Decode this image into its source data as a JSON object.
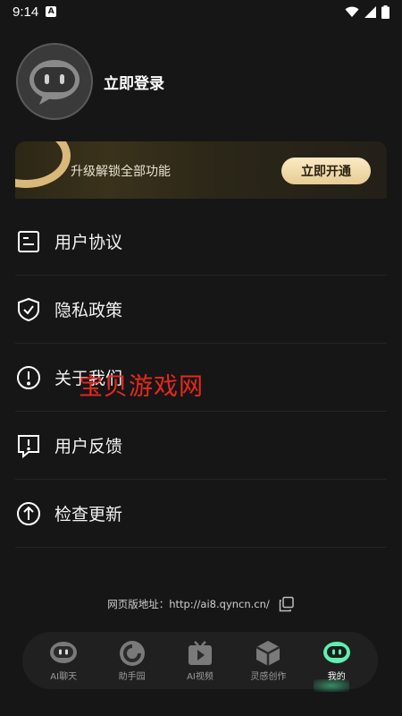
{
  "status_bar": {
    "time": "9:14",
    "notif_letter": "A"
  },
  "profile": {
    "login_label": "立即登录"
  },
  "vip": {
    "text": "升级解锁全部功能",
    "button": "立即开通"
  },
  "menu": [
    {
      "label": "用户协议",
      "icon": "document-icon"
    },
    {
      "label": "隐私政策",
      "icon": "shield-check-icon"
    },
    {
      "label": "关于我们",
      "icon": "info-circle-icon"
    },
    {
      "label": "用户反馈",
      "icon": "feedback-icon"
    },
    {
      "label": "检查更新",
      "icon": "arrow-up-circle-icon"
    }
  ],
  "watermark": "宝贝游戏网",
  "web_address": {
    "label": "网页版地址：",
    "url": "http://ai8.qyncn.cn/"
  },
  "bottom_nav": [
    {
      "label": "AI聊天",
      "active": false
    },
    {
      "label": "助手园",
      "active": false
    },
    {
      "label": "AI视频",
      "active": false
    },
    {
      "label": "灵感创作",
      "active": false
    },
    {
      "label": "我的",
      "active": true
    }
  ],
  "colors": {
    "background": "#161616",
    "accent_gold": "#e6cc96",
    "accent_green": "#46e6a0"
  }
}
